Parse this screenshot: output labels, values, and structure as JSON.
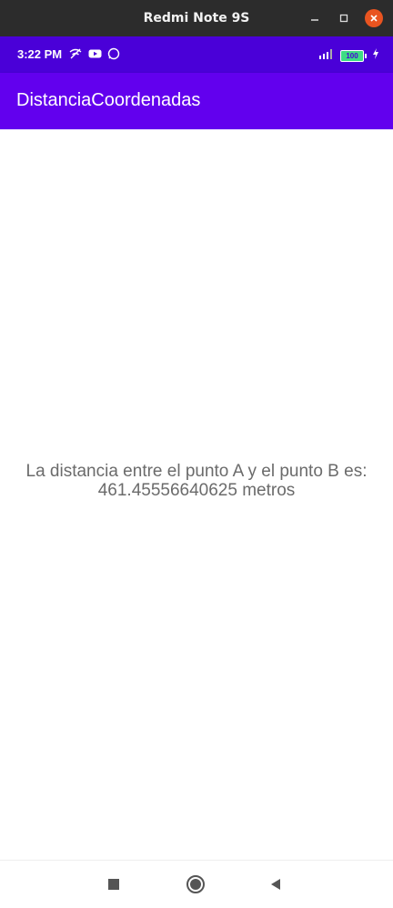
{
  "window": {
    "title": "Redmi Note 9S",
    "controls": [
      "minimize-icon",
      "maximize-icon",
      "close-icon"
    ]
  },
  "status_bar": {
    "time": "3:22 PM",
    "left_icons": [
      "wifi-off-icon",
      "youtube-icon",
      "whatsapp-icon"
    ],
    "right_icons": [
      "signal-icon",
      "battery-icon",
      "charging-icon"
    ],
    "battery_label": "100"
  },
  "app_bar": {
    "title": "DistanciaCoordenadas",
    "color": "#6200ee",
    "status_color": "#4a00d8"
  },
  "main": {
    "result_line1": "La distancia entre el punto A y el punto B es:",
    "result_line2": "461.45556640625 metros"
  },
  "nav_bar": {
    "buttons": [
      "recents-icon",
      "home-icon",
      "back-icon"
    ]
  }
}
